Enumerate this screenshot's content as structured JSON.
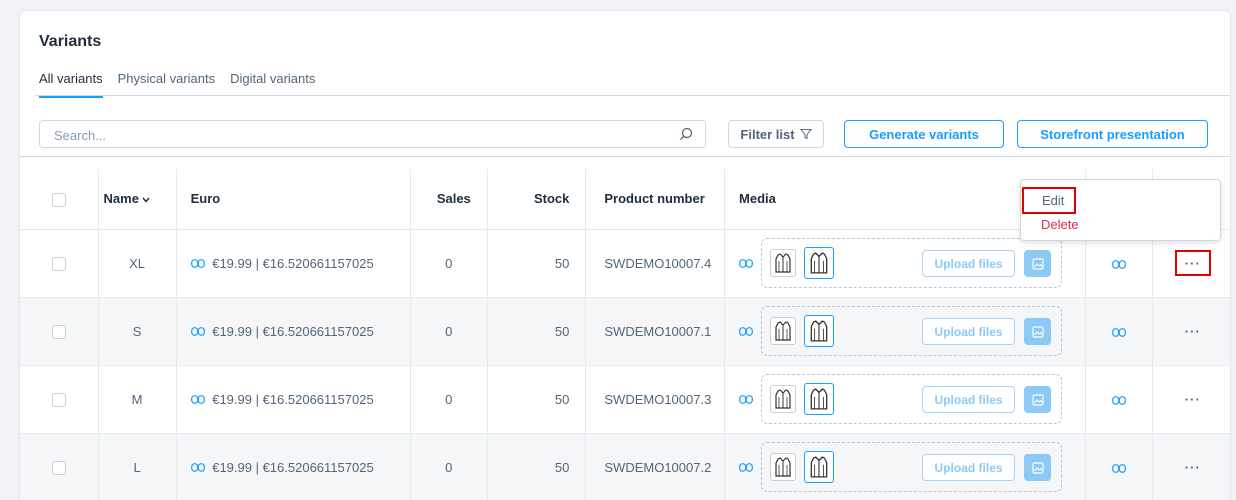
{
  "card": {
    "title": "Variants",
    "tabs": [
      "All variants",
      "Physical variants",
      "Digital variants"
    ]
  },
  "toolbar": {
    "search_placeholder": "Search...",
    "filter_label": "Filter list",
    "generate_label": "Generate variants",
    "storefront_label": "Storefront presentation"
  },
  "table": {
    "headers": {
      "name": "Name",
      "euro": "Euro",
      "sales": "Sales",
      "stock": "Stock",
      "product_number": "Product number",
      "media": "Media"
    },
    "upload_label": "Upload files",
    "more_label": "···",
    "rows": [
      {
        "name": "XL",
        "euro": "€19.99 | €16.520661157025",
        "sales": "0",
        "stock": "50",
        "product_number": "SWDEMO10007.4"
      },
      {
        "name": "S",
        "euro": "€19.99 | €16.520661157025",
        "sales": "0",
        "stock": "50",
        "product_number": "SWDEMO10007.1"
      },
      {
        "name": "M",
        "euro": "€19.99 | €16.520661157025",
        "sales": "0",
        "stock": "50",
        "product_number": "SWDEMO10007.3"
      },
      {
        "name": "L",
        "euro": "€19.99 | €16.520661157025",
        "sales": "0",
        "stock": "50",
        "product_number": "SWDEMO10007.2"
      }
    ]
  },
  "context_menu": {
    "edit": "Edit",
    "delete": "Delete"
  },
  "colors": {
    "accent": "#189eff",
    "danger": "#de294c",
    "highlight": "#e00000"
  }
}
